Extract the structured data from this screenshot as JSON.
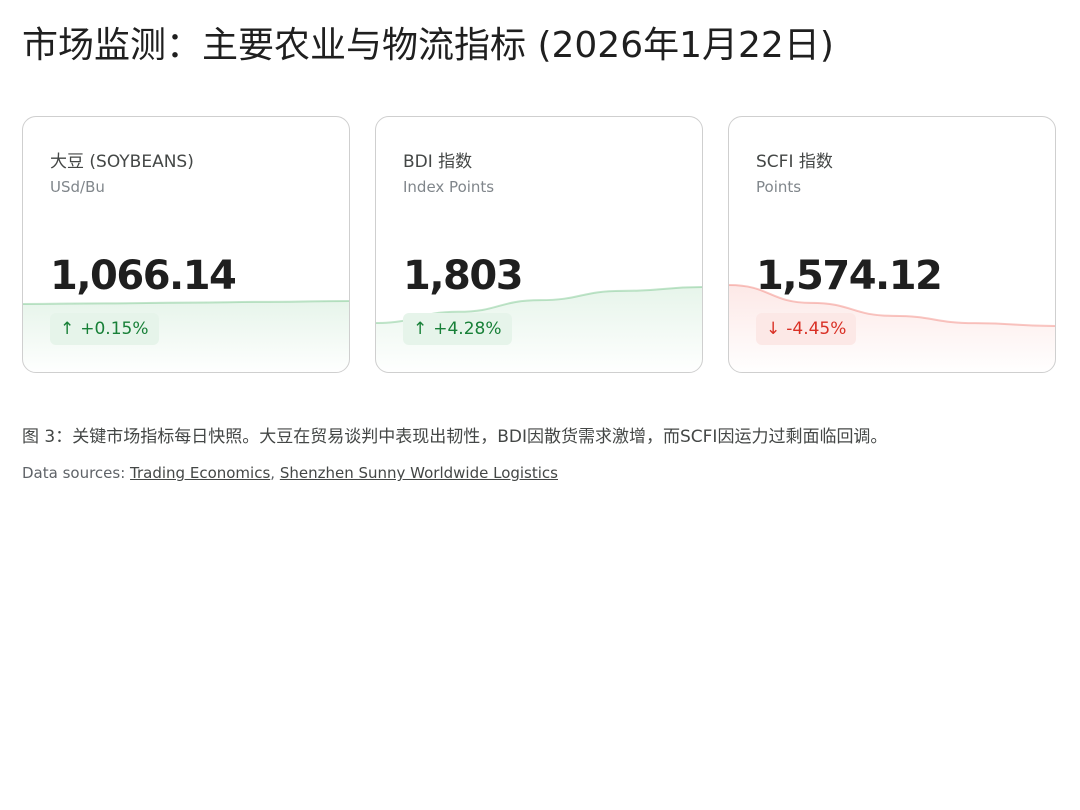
{
  "title": "市场监测：主要农业与物流指标 (2026年1月22日)",
  "chart_data": [
    {
      "type": "line",
      "title": "大豆 (SOYBEANS)",
      "unit": "USd/Bu",
      "value": "1,066.14",
      "change": "+0.15%",
      "direction": "up",
      "y": [
        1062.5,
        1063.3,
        1064.2,
        1065.1,
        1066.14
      ],
      "color": "#34a853"
    },
    {
      "type": "line",
      "title": "BDI 指数",
      "unit": "Index Points",
      "value": "1,803",
      "change": "+4.28%",
      "direction": "up",
      "y": [
        1729,
        1752,
        1776,
        1795,
        1803
      ],
      "color": "#34a853"
    },
    {
      "type": "line",
      "title": "SCFI 指数",
      "unit": "Points",
      "value": "1,574.12",
      "change": "-4.45%",
      "direction": "down",
      "y": [
        1647.4,
        1615.5,
        1592.3,
        1579.2,
        1574.12
      ],
      "color": "#ea4335"
    }
  ],
  "caption": "图 3：关键市场指标每日快照。大豆在贸易谈判中表现出韧性，BDI因散货需求激增，而SCFI因运力过剩面临回调。",
  "sources": {
    "prefix": "Data sources: ",
    "links": [
      "Trading Economics",
      "Shenzhen Sunny Worldwide Logistics"
    ],
    "separator": ", "
  },
  "icons": {
    "up": "↑",
    "down": "↓"
  }
}
